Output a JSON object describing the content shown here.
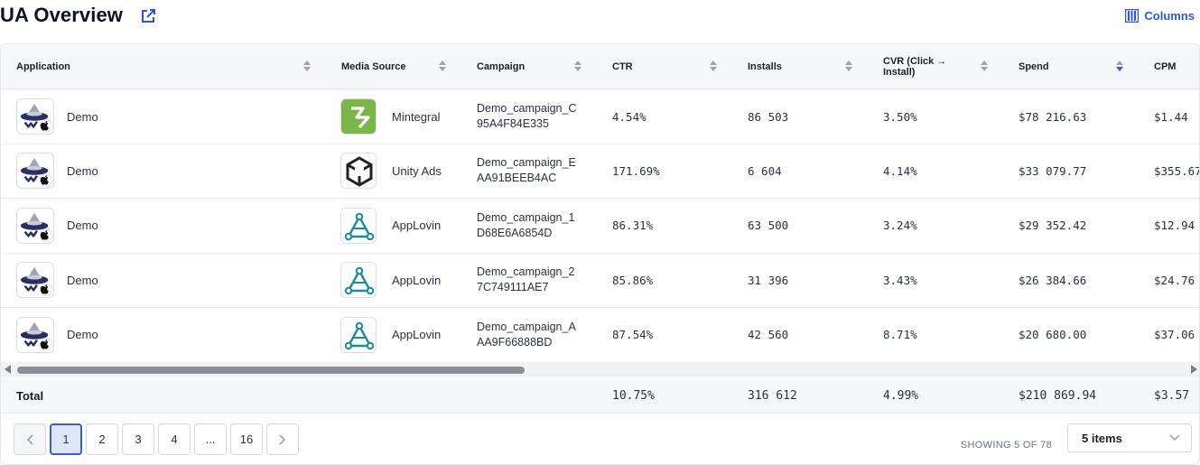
{
  "header": {
    "title": "UA Overview",
    "columns_label": "Columns"
  },
  "columns": [
    {
      "label": "Application"
    },
    {
      "label": "Media Source"
    },
    {
      "label": "Campaign"
    },
    {
      "label": "CTR"
    },
    {
      "label": "Installs"
    },
    {
      "label": "CVR (Click →",
      "label2": "Install)"
    },
    {
      "label": "Spend"
    },
    {
      "label": "CPM"
    }
  ],
  "rows": [
    {
      "application": "Demo",
      "media_source": "Mintegral",
      "media_icon": "mintegral-logo",
      "campaign_1": "Demo_campaign_C",
      "campaign_2": "95A4F84E335",
      "ctr": "4.54%",
      "installs": "86 503",
      "cvr": "3.50%",
      "spend": "$78 216.63",
      "cpm": "$1.44"
    },
    {
      "application": "Demo",
      "media_source": "Unity Ads",
      "media_icon": "unity-logo",
      "campaign_1": "Demo_campaign_E",
      "campaign_2": "AA91BEEB4AC",
      "ctr": "171.69%",
      "installs": "6 604",
      "cvr": "4.14%",
      "spend": "$33 079.77",
      "cpm": "$355.67"
    },
    {
      "application": "Demo",
      "media_source": "AppLovin",
      "media_icon": "applovin-logo",
      "campaign_1": "Demo_campaign_1",
      "campaign_2": "D68E6A6854D",
      "ctr": "86.31%",
      "installs": "63 500",
      "cvr": "3.24%",
      "spend": "$29 352.42",
      "cpm": "$12.94"
    },
    {
      "application": "Demo",
      "media_source": "AppLovin",
      "media_icon": "applovin-logo",
      "campaign_1": "Demo_campaign_2",
      "campaign_2": "7C749111AE7",
      "ctr": "85.86%",
      "installs": "31 396",
      "cvr": "3.43%",
      "spend": "$26 384.66",
      "cpm": "$24.76"
    },
    {
      "application": "Demo",
      "media_source": "AppLovin",
      "media_icon": "applovin-logo",
      "campaign_1": "Demo_campaign_A",
      "campaign_2": "AA9F66888BD",
      "ctr": "87.54%",
      "installs": "42 560",
      "cvr": "8.71%",
      "spend": "$20 680.00",
      "cpm": "$37.06"
    }
  ],
  "totals": {
    "label": "Total",
    "ctr": "10.75%",
    "installs": "316 612",
    "cvr": "4.99%",
    "spend": "$210 869.94",
    "cpm": "$3.57"
  },
  "pagination": {
    "pages": [
      "1",
      "2",
      "3",
      "4",
      "...",
      "16"
    ],
    "current": "1",
    "showing": "SHOWING 5 OF 78",
    "items_per_page": "5 items"
  },
  "colors": {
    "accent": "#2d55d9",
    "active_page_bg": "#dfe7ff",
    "header_bg": "#f6f7f9"
  }
}
